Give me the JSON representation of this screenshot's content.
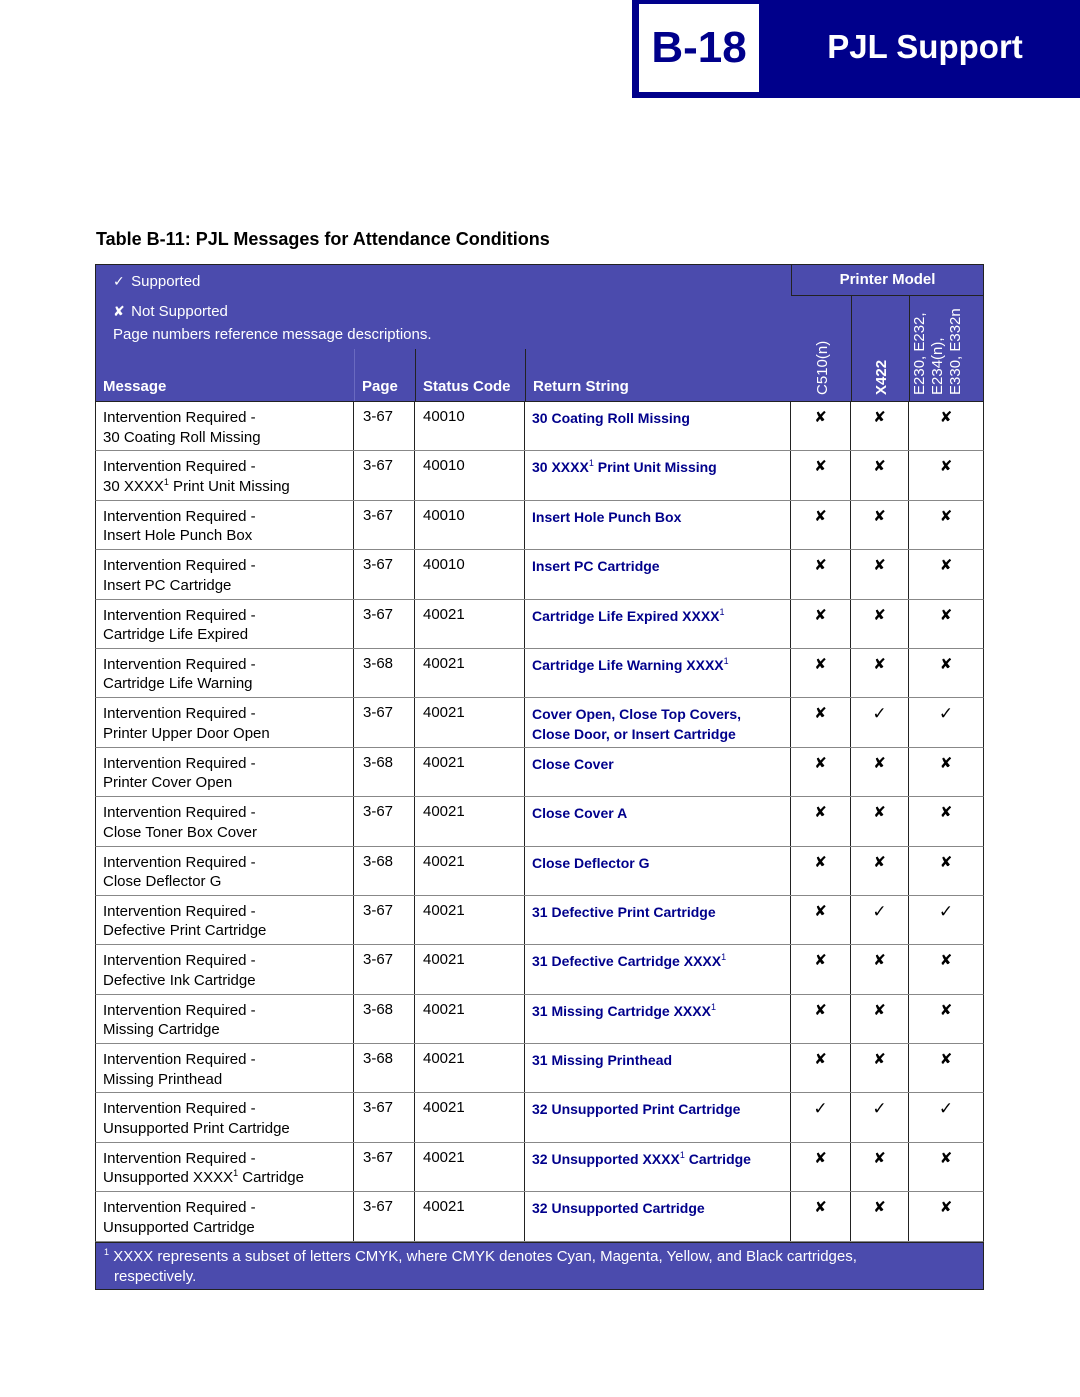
{
  "banner": {
    "section_number": "B-18",
    "title": "PJL Support"
  },
  "table_title": "Table B-11:  PJL Messages for Attendance Conditions",
  "legend": {
    "supported_symbol": "✓",
    "supported_label": "Supported",
    "not_supported_symbol": "✘",
    "not_supported_label": "Not Supported",
    "note": "Page numbers reference message descriptions."
  },
  "columns": {
    "message": "Message",
    "page": "Page",
    "status_code": "Status Code",
    "return_string": "Return String",
    "printer_model": "Printer Model",
    "models": [
      "C510(n)",
      "X422",
      "E230, E232, E234(n), E330, E332n"
    ],
    "model_lines_3": [
      "E230, E232,",
      "E234(n),",
      "E330, E332n"
    ]
  },
  "symbols": {
    "yes": "✓",
    "no": "✘"
  },
  "rows": [
    {
      "msg1": "Intervention Required -",
      "msg2": "30 Coating Roll Missing",
      "page": "3-67",
      "code": "40010",
      "ret": "30 Coating Roll Missing",
      "support": [
        "no",
        "no",
        "no"
      ]
    },
    {
      "msg1": "Intervention Required -",
      "msg2": "30 XXXX¹ Print Unit Missing",
      "page": "3-67",
      "code": "40010",
      "ret": "30 XXXX¹ Print Unit Missing",
      "support": [
        "no",
        "no",
        "no"
      ]
    },
    {
      "msg1": "Intervention Required -",
      "msg2": "Insert Hole Punch Box",
      "page": "3-67",
      "code": "40010",
      "ret": "Insert Hole Punch Box",
      "support": [
        "no",
        "no",
        "no"
      ]
    },
    {
      "msg1": "Intervention Required -",
      "msg2": "Insert PC Cartridge",
      "page": "3-67",
      "code": "40010",
      "ret": "Insert PC Cartridge",
      "support": [
        "no",
        "no",
        "no"
      ]
    },
    {
      "msg1": "Intervention Required -",
      "msg2": "Cartridge Life Expired",
      "page": "3-67",
      "code": "40021",
      "ret": "Cartridge Life Expired XXXX¹",
      "support": [
        "no",
        "no",
        "no"
      ]
    },
    {
      "msg1": "Intervention Required -",
      "msg2": "Cartridge Life Warning",
      "page": "3-68",
      "code": "40021",
      "ret": "Cartridge Life Warning XXXX¹",
      "support": [
        "no",
        "no",
        "no"
      ]
    },
    {
      "msg1": "Intervention Required -",
      "msg2": "Printer Upper Door Open",
      "page": "3-67",
      "code": "40021",
      "ret": "Cover Open, Close Top Covers,",
      "ret2": "Close Door, or Insert Cartridge",
      "support": [
        "no",
        "yes",
        "yes"
      ]
    },
    {
      "msg1": "Intervention Required -",
      "msg2": "Printer Cover Open",
      "page": "3-68",
      "code": "40021",
      "ret": "Close Cover",
      "support": [
        "no",
        "no",
        "no"
      ]
    },
    {
      "msg1": "Intervention Required -",
      "msg2": "Close Toner Box Cover",
      "page": "3-67",
      "code": "40021",
      "ret": "Close Cover A",
      "support": [
        "no",
        "no",
        "no"
      ]
    },
    {
      "msg1": "Intervention Required -",
      "msg2": "Close Deflector G",
      "page": "3-68",
      "code": "40021",
      "ret": "Close Deflector G",
      "support": [
        "no",
        "no",
        "no"
      ]
    },
    {
      "msg1": "Intervention Required -",
      "msg2": "Defective Print Cartridge",
      "page": "3-67",
      "code": "40021",
      "ret": "31 Defective Print Cartridge",
      "support": [
        "no",
        "yes",
        "yes"
      ]
    },
    {
      "msg1": "Intervention Required -",
      "msg2": "Defective Ink Cartridge",
      "page": "3-67",
      "code": "40021",
      "ret": "31 Defective Cartridge XXXX¹",
      "support": [
        "no",
        "no",
        "no"
      ]
    },
    {
      "msg1": "Intervention Required -",
      "msg2": "Missing Cartridge",
      "page": "3-68",
      "code": "40021",
      "ret": "31 Missing Cartridge XXXX¹",
      "support": [
        "no",
        "no",
        "no"
      ]
    },
    {
      "msg1": "Intervention Required -",
      "msg2": "Missing Printhead",
      "page": "3-68",
      "code": "40021",
      "ret": "31 Missing Printhead",
      "support": [
        "no",
        "no",
        "no"
      ]
    },
    {
      "msg1": "Intervention Required -",
      "msg2": "Unsupported Print Cartridge",
      "page": "3-67",
      "code": "40021",
      "ret": "32 Unsupported Print Cartridge",
      "support": [
        "yes",
        "yes",
        "yes"
      ]
    },
    {
      "msg1": "Intervention Required -",
      "msg2": "Unsupported XXXX¹ Cartridge",
      "page": "3-67",
      "code": "40021",
      "ret": "32 Unsupported XXXX¹ Cartridge",
      "support": [
        "no",
        "no",
        "no"
      ]
    },
    {
      "msg1": "Intervention Required -",
      "msg2": "Unsupported Cartridge",
      "page": "3-67",
      "code": "40021",
      "ret": "32 Unsupported Cartridge",
      "support": [
        "no",
        "no",
        "no"
      ]
    }
  ],
  "footnote": {
    "marker": "1",
    "line1": "XXXX represents a subset of letters CMYK, where CMYK denotes Cyan, Magenta, Yellow, and Black cartridges,",
    "line2": "respectively."
  },
  "colors": {
    "banner_navy": "#00008b",
    "table_header_purple": "#4b4bad",
    "return_string_blue": "#00008b"
  }
}
